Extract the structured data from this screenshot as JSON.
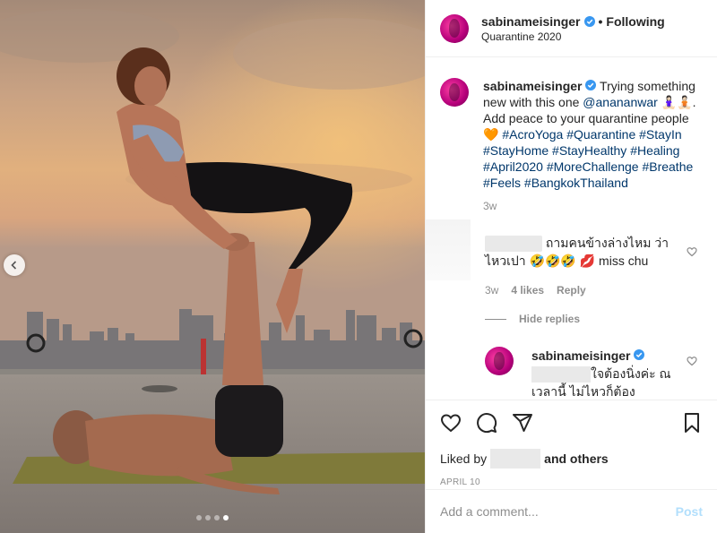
{
  "post": {
    "username": "sabinameisinger",
    "separator": "•",
    "follow_status": "Following",
    "location": "Quarantine 2020"
  },
  "caption": {
    "username": "sabinameisinger",
    "text_pre": "Trying something new with this one",
    "mention": "@anananwar",
    "emoji": "🧘🏻‍♀️🧘🏻",
    "text_post": ". Add peace to your quarantine people",
    "heart": "🧡",
    "hashtags": "#AcroYoga #Quarantine #StayIn #StayHome #StayHealthy #Healing #April2020 #MoreChallenge #Breathe #Feels #BangkokThailand",
    "time": "3w"
  },
  "comment": {
    "text": "ถามคนข้างล่างไหม ว่าไหวเปา 🤣🤣🤣 💋 miss chu",
    "time": "3w",
    "likes": "4 likes",
    "reply_label": "Reply"
  },
  "hide_replies": "Hide replies",
  "reply": {
    "username": "sabinameisinger",
    "text": "ใจต้องนิ่งค่ะ ณ เวลานี้ ไม่ไหวก็ต้อง"
  },
  "likes": {
    "prefix": "Liked by",
    "suffix": "and others"
  },
  "date": "APRIL 10",
  "add_comment": {
    "placeholder": "Add a comment...",
    "post_label": "Post"
  },
  "carousel": {
    "count": 4,
    "active_index": 3
  },
  "colors": {
    "link": "#00376b",
    "verified": "#3897f0",
    "post_disabled": "#b2dffc",
    "meta_gray": "#8e8e8e"
  },
  "icons": [
    "chevron-left-icon",
    "verified-badge-icon",
    "heart-icon",
    "comment-icon",
    "share-icon",
    "bookmark-icon"
  ]
}
